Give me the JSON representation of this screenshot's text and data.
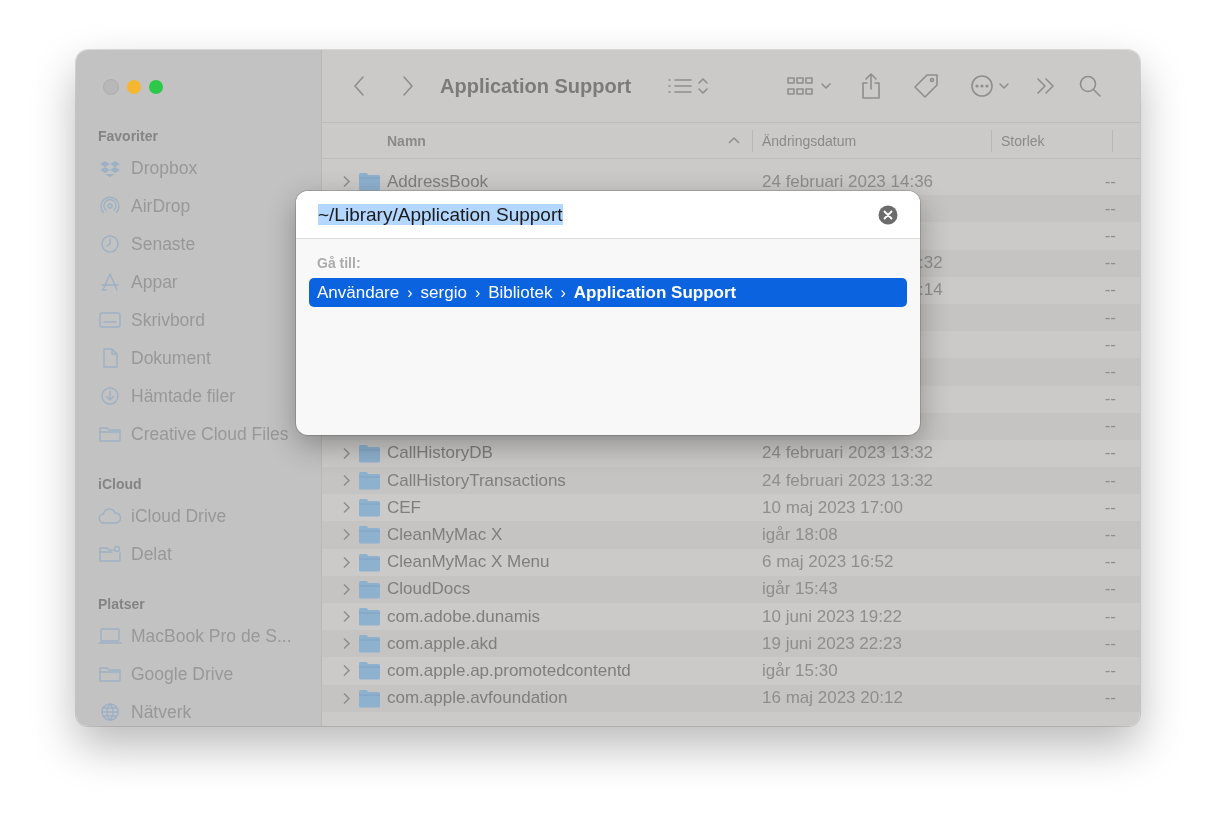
{
  "window": {
    "title": "Application Support"
  },
  "sidebar": {
    "sections": [
      {
        "heading": "Favoriter",
        "items": [
          {
            "label": "Dropbox"
          },
          {
            "label": "AirDrop"
          },
          {
            "label": "Senaste"
          },
          {
            "label": "Appar"
          },
          {
            "label": "Skrivbord"
          },
          {
            "label": "Dokument"
          },
          {
            "label": "Hämtade filer"
          },
          {
            "label": "Creative Cloud Files"
          }
        ]
      },
      {
        "heading": "iCloud",
        "items": [
          {
            "label": "iCloud Drive"
          },
          {
            "label": "Delat"
          }
        ]
      },
      {
        "heading": "Platser",
        "items": [
          {
            "label": "MacBook Pro de S..."
          },
          {
            "label": "Google Drive"
          },
          {
            "label": "Nätverk"
          }
        ]
      }
    ]
  },
  "columns": [
    {
      "label": "Namn",
      "sorted": true
    },
    {
      "label": "Ändringsdatum",
      "sorted": false
    },
    {
      "label": "Storlek",
      "sorted": false
    }
  ],
  "rows": [
    {
      "name": "AddressBook",
      "date": "24 februari 2023 14:36",
      "size": "--"
    },
    {
      "size": "--"
    },
    {
      "size": "--"
    },
    {
      "date": ":32",
      "size": "--"
    },
    {
      "date": ":14",
      "size": "--"
    },
    {
      "size": "--"
    },
    {
      "size": "--"
    },
    {
      "size": "--"
    },
    {
      "size": "--"
    },
    {
      "size": "--"
    },
    {
      "name": "CallHistoryDB",
      "date": "24 februari 2023 13:32",
      "size": "--"
    },
    {
      "name": "CallHistoryTransactions",
      "date": "24 februari 2023 13:32",
      "size": "--"
    },
    {
      "name": "CEF",
      "date": "10 maj 2023 17:00",
      "size": "--"
    },
    {
      "name": "CleanMyMac X",
      "date": "igår 18:08",
      "size": "--"
    },
    {
      "name": "CleanMyMac X Menu",
      "date": "6 maj 2023 16:52",
      "size": "--"
    },
    {
      "name": "CloudDocs",
      "date": "igår 15:43",
      "size": "--"
    },
    {
      "name": "com.adobe.dunamis",
      "date": "10 juni 2023 19:22",
      "size": "--"
    },
    {
      "name": "com.apple.akd",
      "date": "19 juni 2023 22:23",
      "size": "--"
    },
    {
      "name": "com.apple.ap.promotedcontentd",
      "date": "igår 15:30",
      "size": "--"
    },
    {
      "name": "com.apple.avfoundation",
      "date": "16 maj 2023 20:12",
      "size": "--"
    }
  ],
  "goto_dialog": {
    "path_field": {
      "value": "~/Library/Application Support"
    },
    "label": "Gå till:",
    "suggestions": [
      {
        "selected": true,
        "segments": [
          {
            "kind": "folder",
            "text": "Användare"
          },
          {
            "kind": "separator",
            "text": "›"
          },
          {
            "kind": "folder",
            "text": "sergio"
          },
          {
            "kind": "separator",
            "text": "›"
          },
          {
            "kind": "folder",
            "text": "Bibliotek"
          },
          {
            "kind": "separator",
            "text": "›"
          },
          {
            "kind": "current",
            "text": "Application Support"
          }
        ]
      }
    ]
  }
}
